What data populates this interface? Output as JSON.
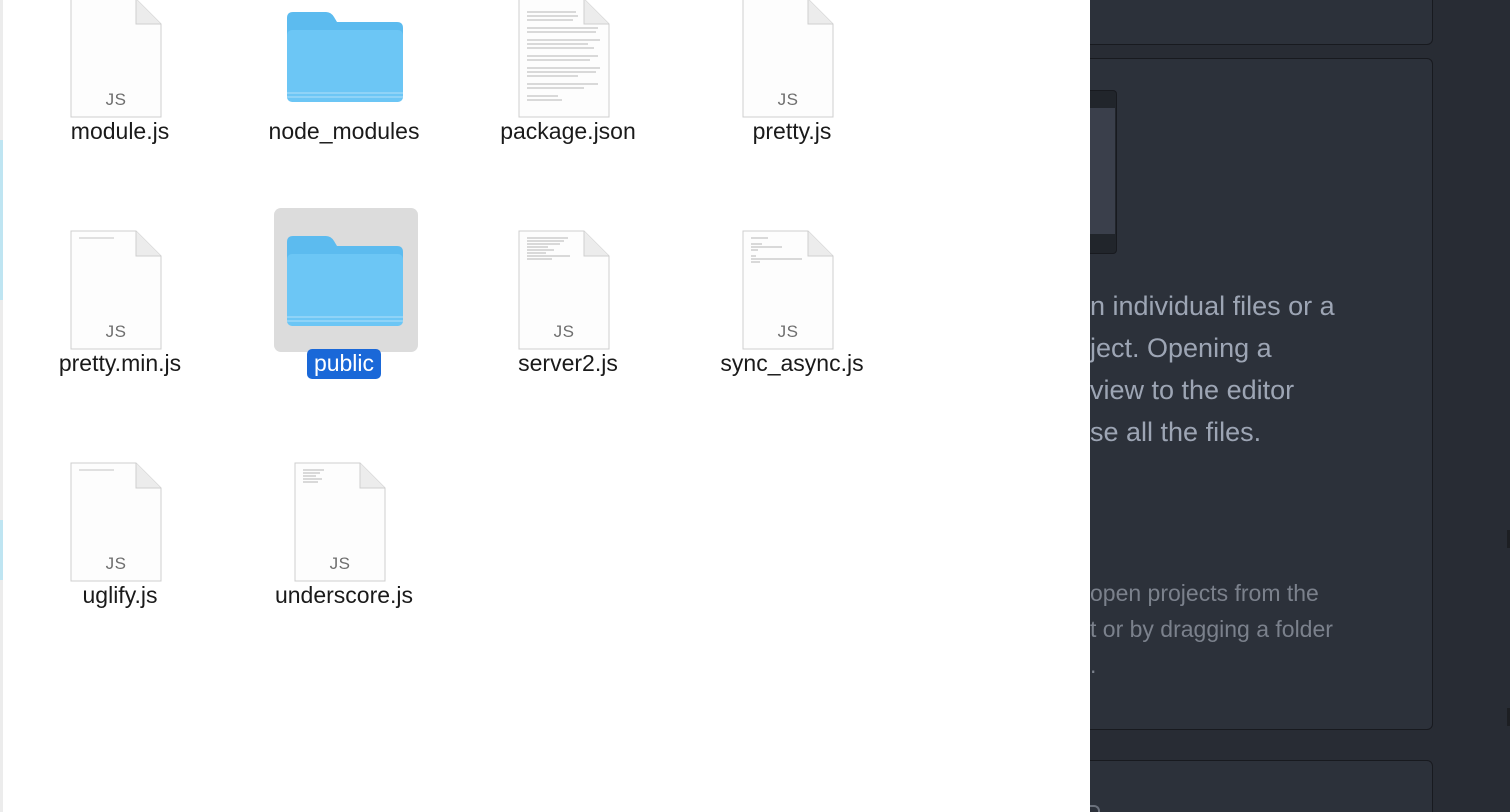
{
  "finder": {
    "files": [
      {
        "name": "module.js",
        "kind": "js",
        "ext_label": "JS",
        "selected": false
      },
      {
        "name": "node_modules",
        "kind": "folder",
        "selected": false
      },
      {
        "name": "package.json",
        "kind": "text",
        "selected": false
      },
      {
        "name": "pretty.js",
        "kind": "js",
        "ext_label": "JS",
        "selected": false
      },
      {
        "name": "pretty.min.js",
        "kind": "js",
        "ext_label": "JS",
        "selected": false
      },
      {
        "name": "public",
        "kind": "folder",
        "selected": true
      },
      {
        "name": "server2.js",
        "kind": "js",
        "ext_label": "JS",
        "selected": false
      },
      {
        "name": "sync_async.js",
        "kind": "js",
        "ext_label": "JS",
        "selected": false
      },
      {
        "name": "uglify.js",
        "kind": "js",
        "ext_label": "JS",
        "selected": false
      },
      {
        "name": "underscore.js",
        "kind": "js",
        "ext_label": "JS",
        "selected": false
      }
    ],
    "colors": {
      "selection": "#1a68d8",
      "selection_bg": "#dcdcdc",
      "folder": "#6cc6f5"
    }
  },
  "editor": {
    "intro_lines": [
      "n individual files or a",
      "ject. Opening a",
      "view to the editor",
      "se all the files."
    ],
    "secondary_lines": [
      " open projects from the",
      "t or by dragging a folder",
      "."
    ],
    "colors": {
      "background": "#282c34",
      "panel": "#2c313a",
      "text": "#9da5b4",
      "muted_text": "#7b818c"
    }
  }
}
